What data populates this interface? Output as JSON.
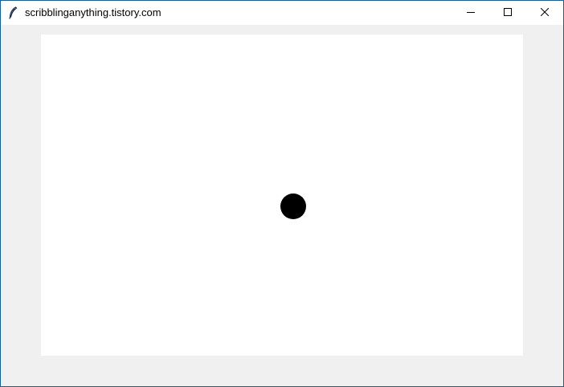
{
  "window": {
    "title": "scribblinganything.tistory.com",
    "icon": "feather-icon",
    "controls": {
      "minimize_icon": "minimize-icon",
      "maximize_icon": "maximize-icon",
      "close_icon": "close-icon"
    }
  },
  "canvas": {
    "background": "#ffffff",
    "shapes": [
      {
        "type": "circle",
        "fill": "#000000"
      }
    ]
  },
  "colors": {
    "frame_border": "#1a5f8f",
    "client_background": "#f0f0f0",
    "titlebar_background": "#ffffff"
  }
}
